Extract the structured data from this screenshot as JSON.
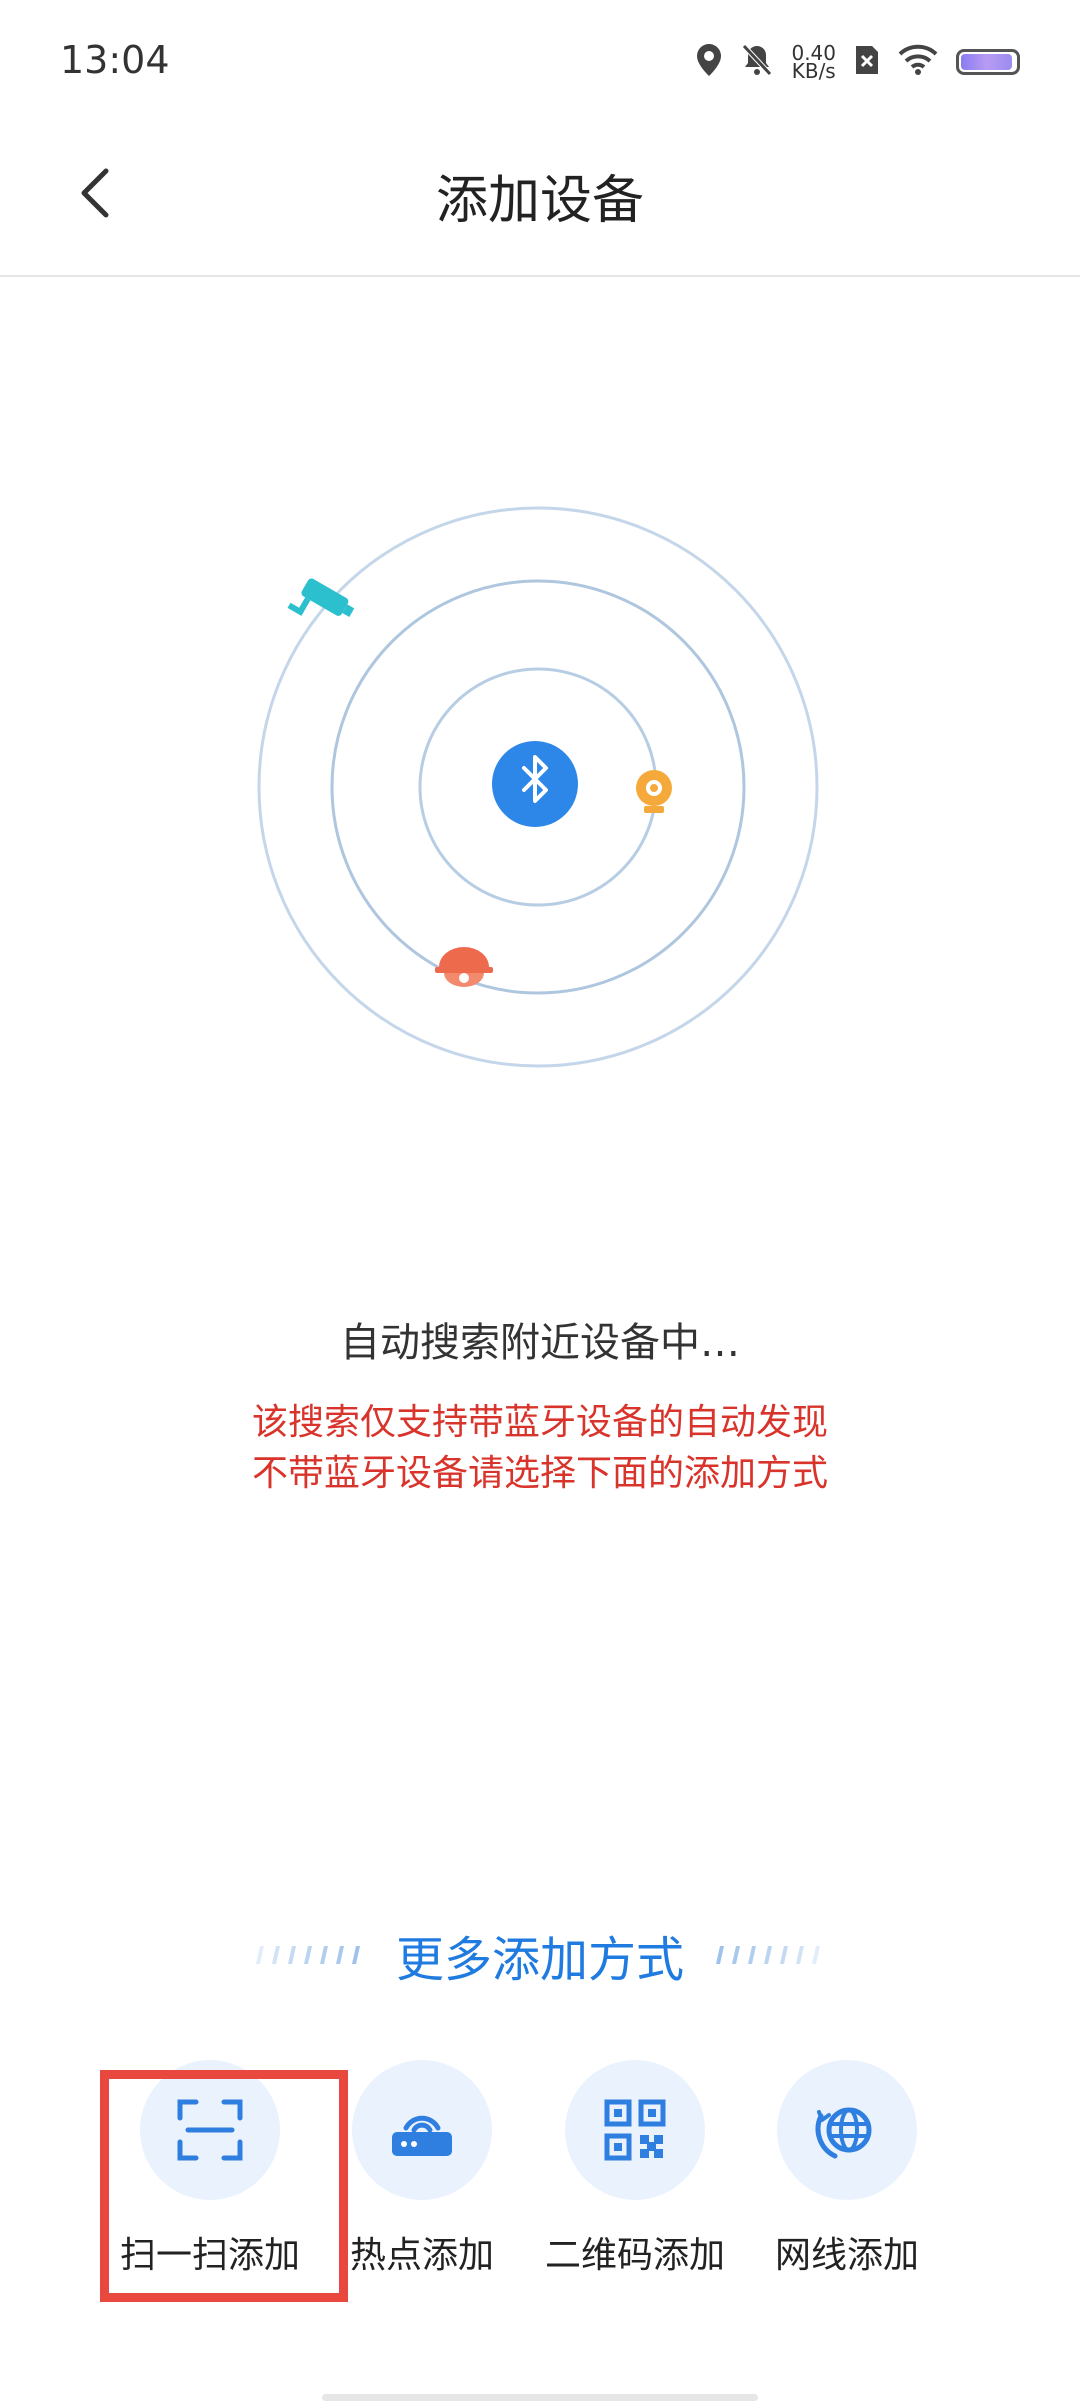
{
  "status_bar": {
    "time": "13:04",
    "net_speed_value": "0.40",
    "net_speed_unit": "KB/s",
    "battery_level": 0.95,
    "icons": [
      "location-icon",
      "mute-icon",
      "no-sim-icon",
      "wifi-icon",
      "battery-icon"
    ]
  },
  "header": {
    "title": "添加设备",
    "back_icon": "chevron-left-icon"
  },
  "radar": {
    "center_icon": "bluetooth-icon",
    "device_icons": [
      "security-camera-icon",
      "webcam-icon",
      "dome-camera-icon"
    ]
  },
  "search": {
    "status": "自动搜索附近设备中…",
    "hint_line1": "该搜索仅支持带蓝牙设备的自动发现",
    "hint_line2": "不带蓝牙设备请选择下面的添加方式"
  },
  "more_methods": {
    "title": "更多添加方式",
    "items": [
      {
        "label": "扫一扫添加",
        "icon": "scan-icon"
      },
      {
        "label": "热点添加",
        "icon": "hotspot-router-icon"
      },
      {
        "label": "二维码添加",
        "icon": "qr-code-icon"
      },
      {
        "label": "网线添加",
        "icon": "network-cable-icon"
      }
    ]
  },
  "colors": {
    "accent": "#1f7be0",
    "warning": "#d9342b",
    "highlight": "#e8483e",
    "icon_bg": "#eaf2fd"
  }
}
